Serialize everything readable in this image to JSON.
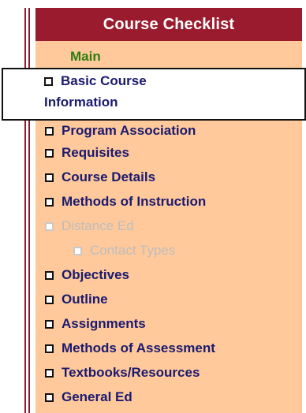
{
  "panel": {
    "title": "Course Checklist",
    "main_label": "Main",
    "basic_info_line1": "Basic Course",
    "basic_info_line2": "Information",
    "items": [
      {
        "label": "Program Association"
      },
      {
        "label": "Requisites"
      },
      {
        "label": "Course Details"
      },
      {
        "label": "Methods of Instruction"
      },
      {
        "label": "Distance Ed",
        "disabled": true
      },
      {
        "label": "Contact Types",
        "disabled": true
      },
      {
        "label": "Objectives"
      },
      {
        "label": "Outline"
      },
      {
        "label": "Assignments"
      },
      {
        "label": "Methods of Assessment"
      },
      {
        "label": "Textbooks/Resources"
      },
      {
        "label": "General Ed"
      }
    ]
  }
}
